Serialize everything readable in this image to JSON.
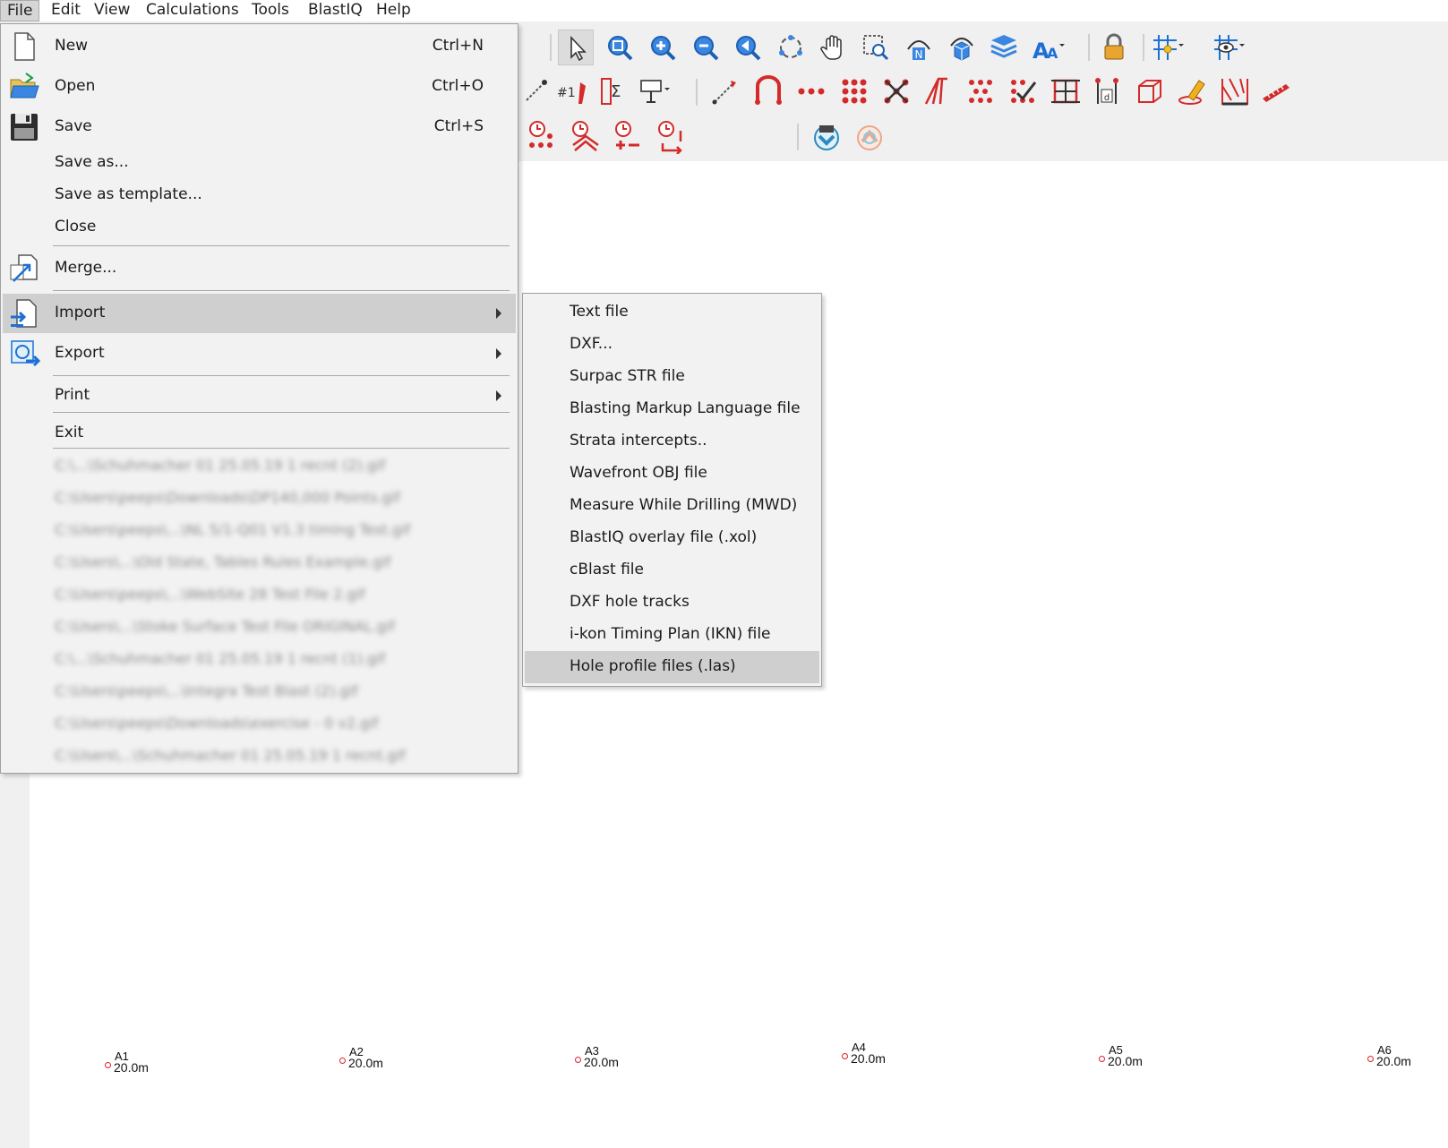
{
  "menubar": {
    "items": [
      "File",
      "Edit",
      "View",
      "Calculations",
      "Tools",
      "BlastIQ",
      "Help"
    ]
  },
  "file_menu": {
    "new": {
      "label": "New",
      "shortcut": "Ctrl+N"
    },
    "open": {
      "label": "Open",
      "shortcut": "Ctrl+O"
    },
    "save": {
      "label": "Save",
      "shortcut": "Ctrl+S"
    },
    "save_as": {
      "label": "Save as..."
    },
    "save_template": {
      "label": "Save as template..."
    },
    "close": {
      "label": "Close"
    },
    "merge": {
      "label": "Merge..."
    },
    "import": {
      "label": "Import"
    },
    "export": {
      "label": "Export"
    },
    "print": {
      "label": "Print"
    },
    "exit": {
      "label": "Exit"
    },
    "recent_files": [
      "C:\\...\\Schuhmacher 01 25.05.19 1 recnt (2).gif",
      "C:\\Users\\peeps\\Downloads\\DP140,000 Points.gif",
      "C:\\Users\\peeps\\...\\NL 5/1-Q01 V1.3 timing Test.gif",
      "C:\\Users\\...\\Old State, Tables Rules Example.gif",
      "C:\\Users\\peeps\\...\\WebSite 28 Test File 2.gif",
      "C:\\Users\\...\\Stoke Surface Test File ORIGINAL.gif",
      "C:\\...\\Schuhmacher 01 25.05.19 1 recnt (1).gif",
      "C:\\Users\\peeps\\...\\Integra Test Blast (2).gif",
      "C:\\Users\\peeps\\Downloads\\exercise - 0 v2.gif",
      "C:\\Users\\...\\Schuhmacher 01 25.05.19 1 recnt.gif"
    ]
  },
  "import_submenu": {
    "items": [
      "Text file",
      "DXF...",
      "Surpac STR file",
      "Blasting Markup Language file",
      "Strata intercepts..",
      "Wavefront OBJ file",
      "Measure While Drilling (MWD)",
      "BlastIQ overlay file (.xol)",
      "cBlast file",
      "DXF hole tracks",
      "i-kon Timing Plan (IKN) file",
      "Hole profile files (.las)"
    ]
  },
  "toolbar": {
    "row1_icons": [
      "select-arrow-icon",
      "zoom-extents-icon",
      "zoom-in-icon",
      "zoom-out-icon",
      "zoom-previous-icon",
      "rotate-icon",
      "pan-hand-icon",
      "zoom-window-icon",
      "north-view-icon",
      "3d-view-icon",
      "layers-icon",
      "text-size-icon",
      "lock-icon",
      "snap-grid-icon",
      "grid-visibility-icon"
    ],
    "row2_icons": [
      "line-tool-icon",
      "hole-number-icon",
      "sum-icon",
      "stemming-icon",
      "line-measure-icon",
      "connector-icon",
      "hole-row-icon",
      "hole-pattern-icon",
      "delete-holes-icon",
      "angle-icon",
      "grid-holes-icon",
      "check-holes-icon",
      "boundary-icon",
      "hole-label-icon",
      "volume-icon",
      "highlighter-icon",
      "face-profile-icon",
      "ruler-icon"
    ],
    "row3_icons": [
      "timing-holes-icon",
      "timing-echelon-icon",
      "timing-delay-icon",
      "timing-swap-icon",
      "blastiq-sync-icon",
      "blastiq-cloud-icon"
    ]
  },
  "holes": [
    {
      "id": "A1",
      "length": "20.0m"
    },
    {
      "id": "A2",
      "length": "20.0m"
    },
    {
      "id": "A3",
      "length": "20.0m"
    },
    {
      "id": "A4",
      "length": "20.0m"
    },
    {
      "id": "A5",
      "length": "20.0m"
    },
    {
      "id": "A6",
      "length": "20.0m"
    }
  ],
  "colors": {
    "accent_red": "#d42a2a",
    "accent_blue": "#1d6fd6",
    "highlight": "#cfcfcf"
  }
}
